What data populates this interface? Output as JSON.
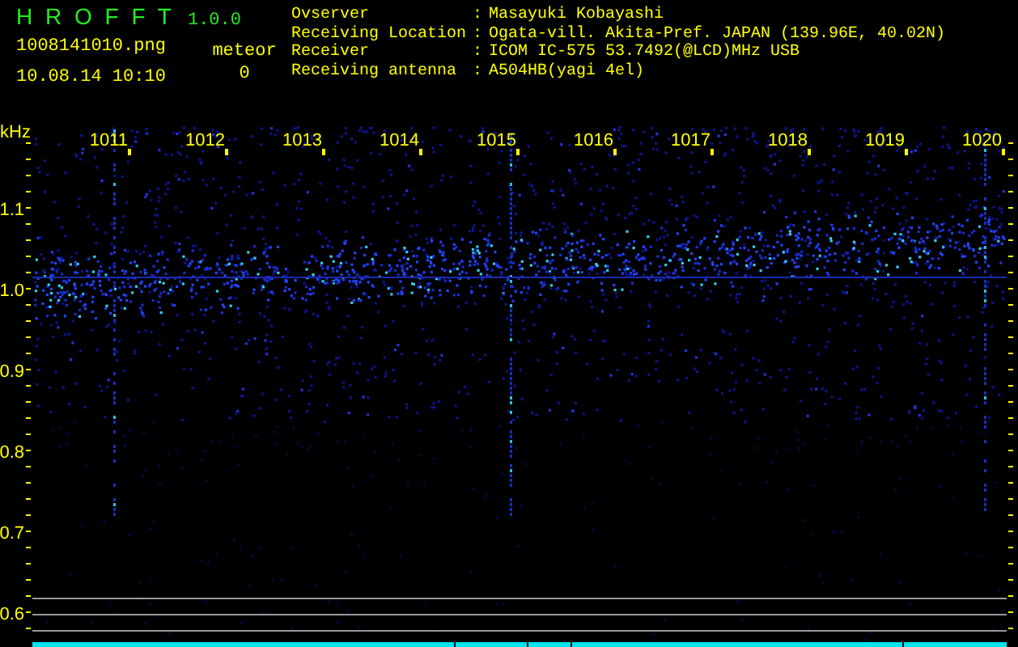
{
  "app": {
    "title": "H R O F F T",
    "version": "1.0.0"
  },
  "file": "1008141010.png",
  "datetime": "10.08.14 10:10",
  "meteor": {
    "label": "meteor",
    "count": "0"
  },
  "separator": ":",
  "station": [
    {
      "label": "Ovserver",
      "value": "Masayuki Kobayashi"
    },
    {
      "label": "Receiving Location",
      "value": "Ogata-vill. Akita-Pref. JAPAN (139.96E, 40.02N)"
    },
    {
      "label": "Receiver",
      "value": "ICOM IC-575 53.7492(@LCD)MHz USB"
    },
    {
      "label": "Receiving antenna",
      "value": "A504HB(yagi 4el)"
    }
  ],
  "spectrogram": {
    "unit": "kHz",
    "x_labels": [
      "1011",
      "1012",
      "1013",
      "1014",
      "1015",
      "1016",
      "1017",
      "1018",
      "1019",
      "1020"
    ],
    "y_labels": [
      "1.1",
      "1.0",
      "0.9",
      "0.8",
      "0.7",
      "0.6"
    ]
  }
}
